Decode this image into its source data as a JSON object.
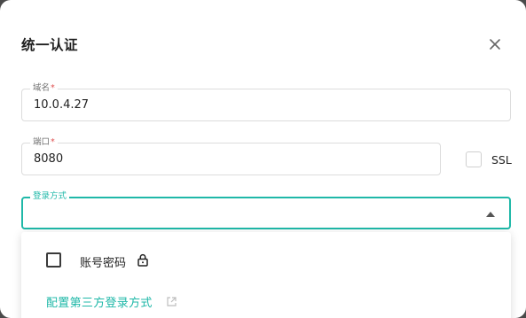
{
  "dialog": {
    "title": "统一认证"
  },
  "fields": {
    "domain": {
      "label": "域名",
      "required_mark": "*",
      "value": "10.0.4.27"
    },
    "port": {
      "label": "端口",
      "required_mark": "*",
      "value": "8080"
    },
    "ssl": {
      "label": "SSL",
      "checked": false
    },
    "login_method": {
      "label": "登录方式",
      "value": ""
    }
  },
  "dropdown": {
    "options": [
      {
        "label": "账号密码",
        "checked": false,
        "icon": "lock-icon"
      }
    ],
    "config_link": "配置第三方登录方式",
    "config_link_icon": "external-link-icon"
  },
  "colors": {
    "accent": "#1fb8a8",
    "required": "#e05252"
  }
}
